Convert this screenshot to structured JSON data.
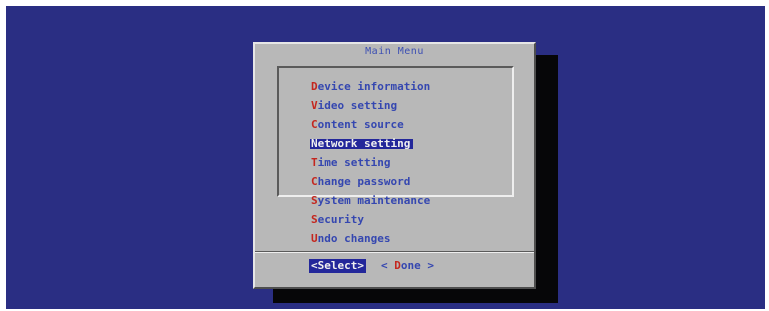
{
  "dialog": {
    "title": "Main Menu"
  },
  "menu": {
    "items": [
      {
        "hotkey": "D",
        "rest": "evice information",
        "selected": false
      },
      {
        "hotkey": "V",
        "rest": "ideo setting",
        "selected": false
      },
      {
        "hotkey": "C",
        "rest": "ontent source",
        "selected": false
      },
      {
        "hotkey": "N",
        "rest": "etwork setting",
        "selected": true
      },
      {
        "hotkey": "T",
        "rest": "ime setting",
        "selected": false
      },
      {
        "hotkey": "C",
        "rest": "hange password",
        "selected": false
      },
      {
        "hotkey": "S",
        "rest": "ystem maintenance",
        "selected": false
      },
      {
        "hotkey": "S",
        "rest": "ecurity",
        "selected": false
      },
      {
        "hotkey": "U",
        "rest": "ndo changes",
        "selected": false
      }
    ]
  },
  "buttons": {
    "select_label": "<Select>",
    "done_prefix": "< ",
    "done_hotkey": "D",
    "done_rest": "one >"
  },
  "colors": {
    "background": "#2a2e83",
    "dialog": "#b8b8b8",
    "text": "#3547b0",
    "hotkey": "#c4261e",
    "highlight": "#23279a",
    "highlight_text": "#f0f0f0"
  }
}
